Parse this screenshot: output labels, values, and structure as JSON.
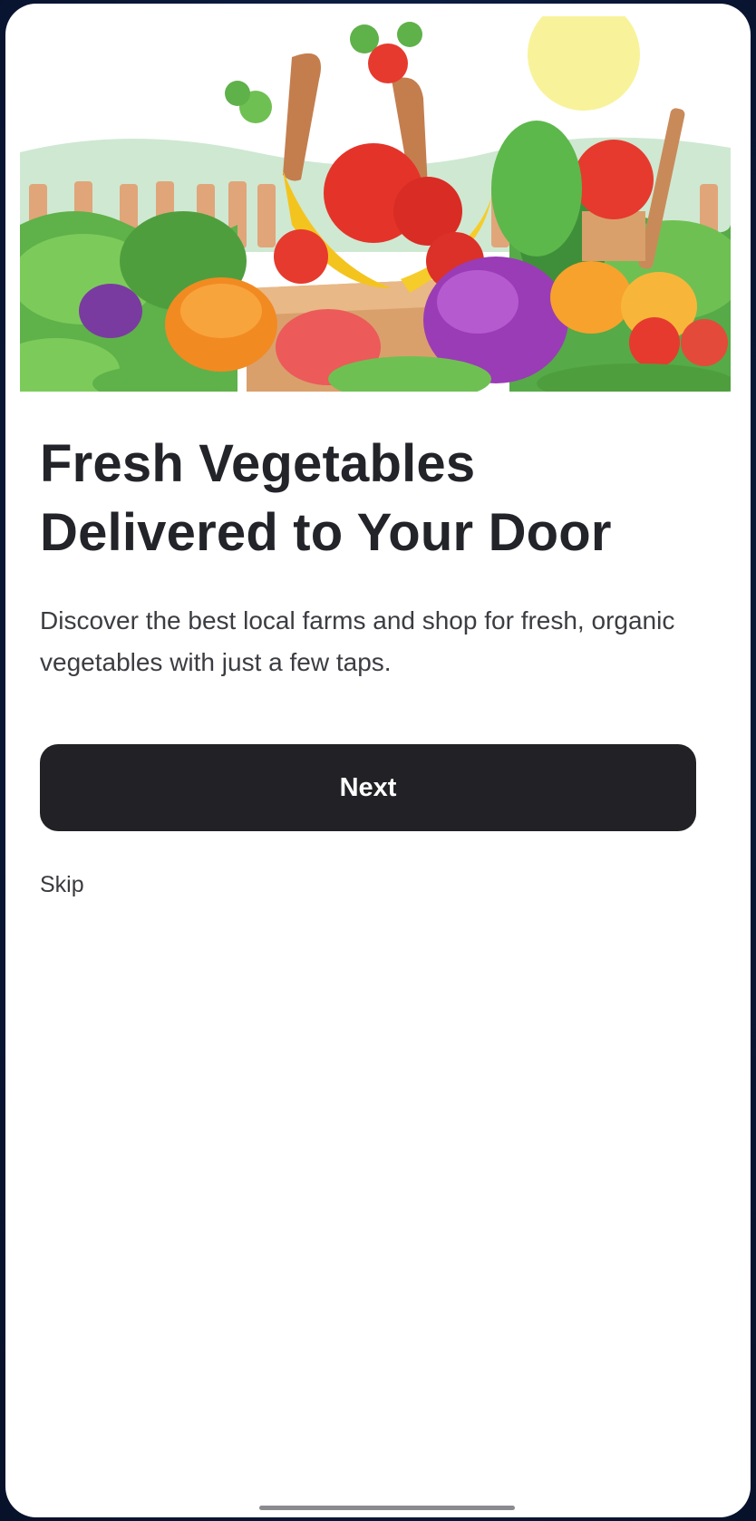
{
  "onboarding": {
    "hero_image": "vegetable-garden-illustration",
    "title": "Fresh Vegetables Delivered to Your Door",
    "subtitle": "Discover the best local farms and shop for fresh, organic vegetables with just a few taps.",
    "next_label": "Next",
    "skip_label": "Skip"
  },
  "colors": {
    "primary_button": "#222226",
    "title_text": "#232429",
    "body_text": "#3c3d42",
    "background": "#ffffff"
  }
}
